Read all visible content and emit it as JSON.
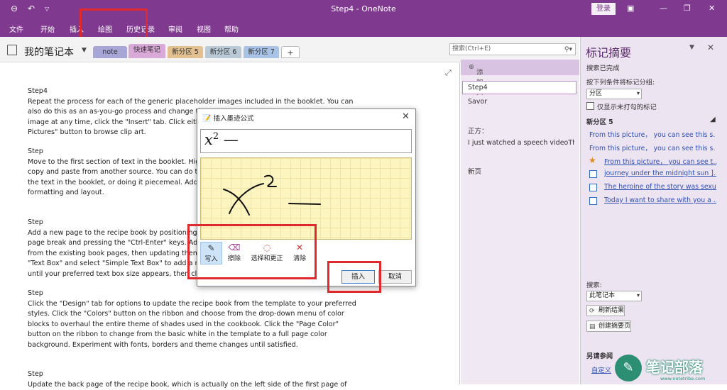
{
  "window": {
    "title": "Step4 - OneNote",
    "login_label": "登录"
  },
  "menu": {
    "items": [
      "文件",
      "开始",
      "插入",
      "绘图",
      "历史记录",
      "审阅",
      "视图",
      "帮助"
    ]
  },
  "notebook": {
    "name": "我的笔记本",
    "tabs": [
      {
        "label": "note",
        "color": "#a8a6d6"
      },
      {
        "label": "快速笔记",
        "color": "#d9a9d8"
      },
      {
        "label": "新分区 5",
        "color": "#e2c08f"
      },
      {
        "label": "新分区 6",
        "color": "#b9c9d6"
      },
      {
        "label": "新分区 7",
        "color": "#a9c3e6"
      },
      {
        "label": "+",
        "color": "#ffffff"
      }
    ],
    "search_placeholder": "搜索(Ctrl+E)"
  },
  "page": {
    "paragraphs": [
      {
        "heading": "Step4",
        "lines": [
          "Repeat the process for each of the generic placeholder images included in the booklet. You can",
          "also do this as an as-you-go process and change th",
          "image at any time, click the \"Insert\" tab. Click eith",
          "Pictures\" button to browse clip art."
        ]
      },
      {
        "heading": "Step",
        "lines": [
          "Move to the first section of text in the booklet. Hig",
          "copy and paste from another source. You can do t",
          "the text in the booklet, or doing it piecemeal. Add",
          "formatting and layout."
        ]
      },
      {
        "heading": "Step",
        "lines": [
          "Add a new page to the recipe book by positioning",
          "page break and pressing the \"Ctrl-Enter\" keys. Ad",
          "from the existing book pages, then updating them",
          "\"Text Box\" and select \"Simple Text Box\" to add a n",
          "until your preferred text box size appears, then cli"
        ]
      },
      {
        "heading": "Step",
        "lines": [
          "Click the \"Design\" tab for options to update the recipe book from the template to your preferred",
          "styles. Click the \"Colors\" button on the ribbon and choose from the drop-down menu of color",
          "blocks to overhaul the entire theme of shades used in the cookbook. Click the \"Page Color\"",
          "button on the ribbon to change from the basic white in the template to a full page color",
          "background. Experiment with fonts, borders and theme changes until satisfied."
        ]
      },
      {
        "heading": "Step",
        "lines": [
          "Update the back page of the recipe book, which is actually on the left side of the first page of"
        ]
      }
    ]
  },
  "pagelist": {
    "add_label": "添加页",
    "items": [
      "Step4",
      "Savor",
      "正方：",
      "I just watched a speech videoTh",
      "新页"
    ]
  },
  "dialog": {
    "title": "插入墨迹公式",
    "math_base": "x",
    "math_exp": "2",
    "math_rest": " —",
    "tools": [
      {
        "label": "写入",
        "icon": "✎"
      },
      {
        "label": "擦除",
        "icon": "⌫"
      },
      {
        "label": "选择和更正",
        "icon": "◌"
      },
      {
        "label": "清除",
        "icon": "✕"
      }
    ],
    "insert_label": "插入",
    "cancel_label": "取消"
  },
  "tags_panel": {
    "title": "标记摘要",
    "status": "搜索已完成",
    "group_label": "按下列条件将标记分组:",
    "group_value": "分区",
    "unchecked_only": "仅显示未打勾的标记",
    "section": "新分区 5",
    "results": [
      {
        "text": "From this picture， you can see this s...",
        "marker": "none"
      },
      {
        "text": "From this picture， you can see this s...",
        "marker": "none"
      },
      {
        "text": "From this picture， you can see t...",
        "marker": "star"
      },
      {
        "text": "journey under the midnight sun ]...",
        "marker": "checkbox"
      },
      {
        "text": "The heroine of the story was sexu...",
        "marker": "checkbox"
      },
      {
        "text": "Today I want to share with you a ...",
        "marker": "checkbox"
      }
    ],
    "search_label": "搜索:",
    "search_value": "此笔记本",
    "refresh_label": "刷新结果",
    "create_label": "创建摘要页",
    "see_also": "另请参阅",
    "customize": "自定义"
  },
  "watermark": {
    "text": "笔记部落",
    "url": "www.notetribe.com"
  }
}
